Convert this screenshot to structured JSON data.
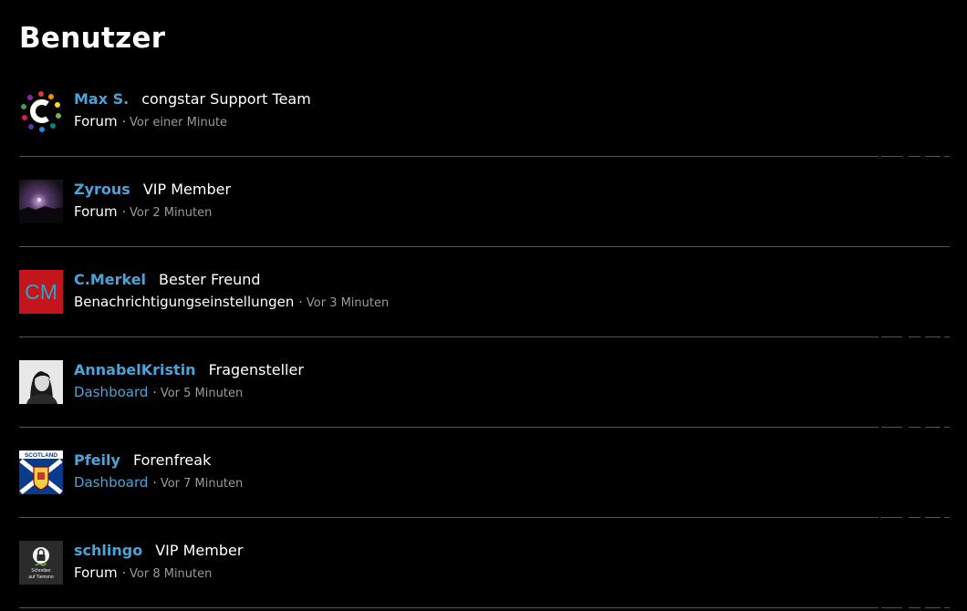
{
  "page": {
    "title": "Benutzer"
  },
  "colors": {
    "background": "#000000",
    "link": "#4ba3d8",
    "divider": "#555555",
    "time": "#9a9a9a"
  },
  "users": [
    {
      "name": "Max S.",
      "rank": "congstar Support Team",
      "location": "Forum",
      "location_is_link": false,
      "time": "Vor einer Minute",
      "avatar": "congstar-logo-icon"
    },
    {
      "name": "Zyrous",
      "rank": "VIP Member",
      "location": "Forum",
      "location_is_link": false,
      "time": "Vor 2 Minuten",
      "avatar": "night-sky-photo-icon"
    },
    {
      "name": "C.Merkel",
      "rank": "Bester Freund",
      "location": "Benachrichtigungseinstellungen",
      "location_is_link": false,
      "time": "Vor 3 Minuten",
      "avatar": "initials-avatar",
      "initials": "CM"
    },
    {
      "name": "AnnabelKristin",
      "rank": "Fragensteller",
      "location": "Dashboard",
      "location_is_link": true,
      "time": "Vor 5 Minuten",
      "avatar": "portrait-photo-icon"
    },
    {
      "name": "Pfeily",
      "rank": "Forenfreak",
      "location": "Dashboard",
      "location_is_link": true,
      "time": "Vor 7 Minuten",
      "avatar": "scotland-crest-icon",
      "crest_text": "SCOTLAND"
    },
    {
      "name": "schlingo",
      "rank": "VIP Member",
      "location": "Forum",
      "location_is_link": false,
      "time": "Vor 8 Minuten",
      "avatar": "lock-badge-icon",
      "badge_text": [
        "Schreiber",
        "auf Tiemvno"
      ]
    }
  ]
}
